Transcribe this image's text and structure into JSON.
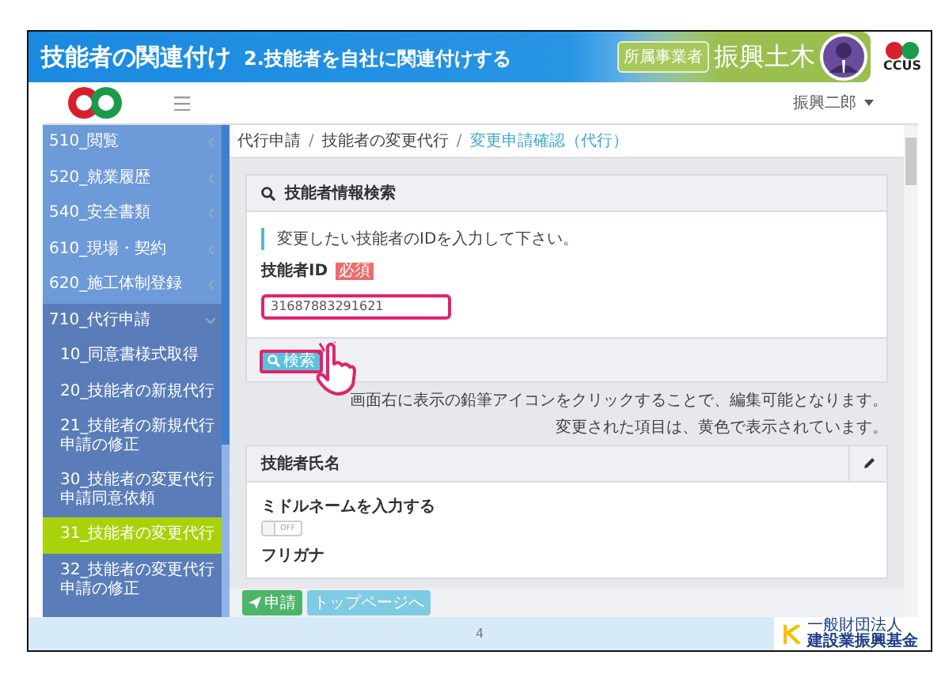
{
  "slide_header": {
    "title": "技能者の関連付け",
    "subtitle": "2.技能者を自社に関連付けする",
    "role_badge": "所属事業者",
    "company": "振興土木",
    "logo_text": "CCUS"
  },
  "app_bar": {
    "user": "振興二郎"
  },
  "sidebar": {
    "items": [
      {
        "label": "510_閲覧",
        "expanded": false
      },
      {
        "label": "520_就業履歴",
        "expanded": false
      },
      {
        "label": "540_安全書類",
        "expanded": false
      },
      {
        "label": "610_現場・契約",
        "expanded": false
      },
      {
        "label": "620_施工体制登録",
        "expanded": false
      },
      {
        "label": "710_代行申請",
        "expanded": true,
        "children": [
          {
            "label": "10_同意書様式取得",
            "selected": false
          },
          {
            "label": "20_技能者の新規代行",
            "selected": false
          },
          {
            "label": "21_技能者の新規代行申請の修正",
            "selected": false
          },
          {
            "label": "30_技能者の変更代行申請同意依頼",
            "selected": false
          },
          {
            "label": "31_技能者の変更代行",
            "selected": true
          },
          {
            "label": "32_技能者の変更代行申請の修正",
            "selected": false
          }
        ]
      }
    ]
  },
  "breadcrumb": {
    "separator": "/",
    "items": [
      "代行申請",
      "技能者の変更代行",
      "変更申請確認（代行）"
    ]
  },
  "search_panel": {
    "title": "技能者情報検索",
    "instruction": "変更したい技能者のIDを入力して下さい。",
    "field_label": "技能者ID",
    "required_badge": "必須",
    "value": "31687883291621",
    "button": "検索"
  },
  "notes": [
    "画面右に表示の鉛筆アイコンをクリックすることで、編集可能となります。",
    "変更された項目は、黄色で表示されています。"
  ],
  "name_panel": {
    "title": "技能者氏名",
    "middle_name_label": "ミドルネームを入力する",
    "middle_name_toggle": {
      "on": false,
      "label": "OFF"
    },
    "furigana_label": "フリガナ"
  },
  "actions": [
    {
      "label": "申請",
      "kind": "primary"
    },
    {
      "label": "トップページへ",
      "kind": "secondary"
    }
  ],
  "footer": {
    "page": "4",
    "org_small": "一般財団法人",
    "org": "建設業振興基金"
  }
}
